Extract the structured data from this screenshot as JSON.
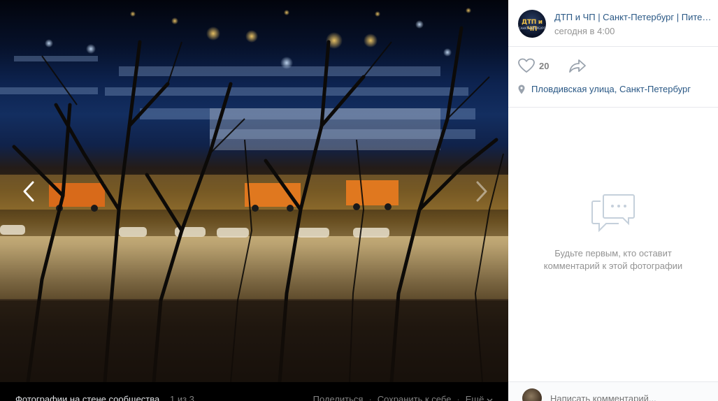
{
  "viewer": {
    "album_title": "Фотографии на стене сообщества",
    "counter": "1 из 3",
    "actions": [
      {
        "label": "Поделиться"
      },
      {
        "label": "Сохранить к себе"
      },
      {
        "label": "Ещё"
      }
    ],
    "separator": "·",
    "more_chevron": "chevron-down-icon"
  },
  "post": {
    "author_name": "ДТП и ЧП | Санкт-Петербург | Питер Онлайн | СПб",
    "date": "сегодня в 4:00",
    "avatar_text": "ДТП и ЧП",
    "avatar_subtext": "САНКТ-ПЕТЕРБУРГ",
    "likes": "20",
    "location": "Пловдивская улица, Санкт-Петербург"
  },
  "comments": {
    "empty_text": "Будьте первым, кто оставит комментарий к этой фотографии",
    "placeholder": "Написать комментарий..."
  },
  "colors": {
    "link": "#2a5885",
    "muted": "#939393",
    "icon": "#99a2ad",
    "viewer_bg": "#000000"
  }
}
